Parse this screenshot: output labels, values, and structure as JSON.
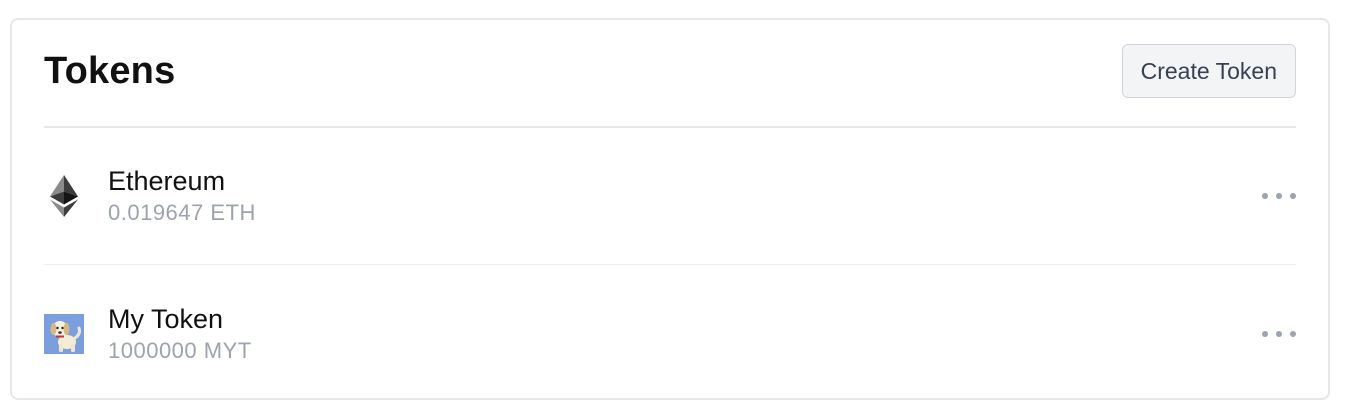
{
  "header": {
    "title": "Tokens",
    "create_button_label": "Create Token"
  },
  "tokens": [
    {
      "name": "Ethereum",
      "balance": "0.019647 ETH",
      "icon": "ethereum-icon"
    },
    {
      "name": "My Token",
      "balance": "1000000 MYT",
      "icon": "dog-avatar-icon"
    }
  ],
  "colors": {
    "border": "#e5e7eb",
    "muted_text": "#9ca3af",
    "button_bg": "#f3f4f6",
    "token_avatar_bg": "#7b9fdc"
  }
}
